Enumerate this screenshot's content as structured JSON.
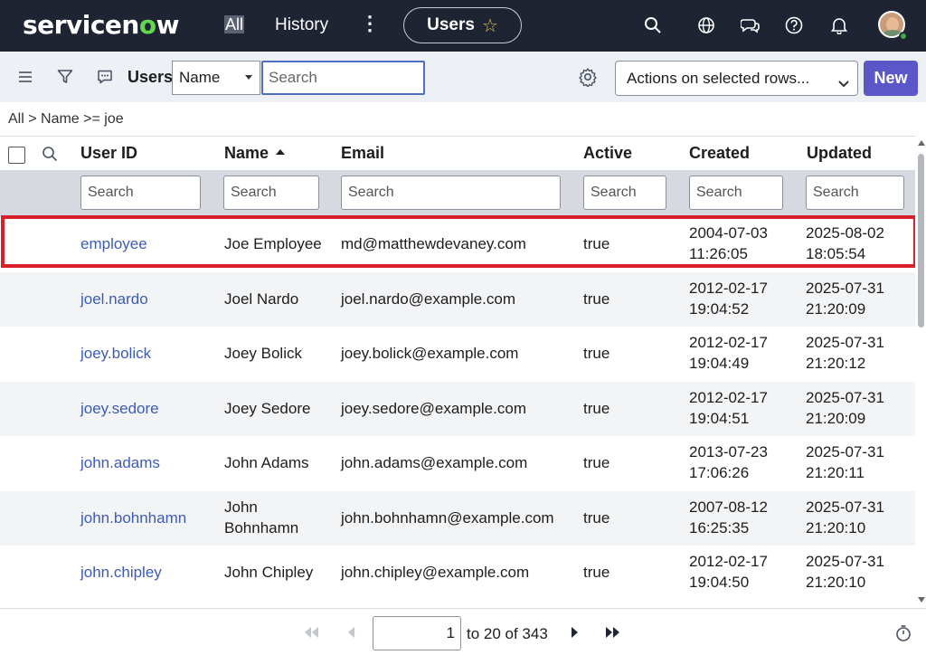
{
  "header": {
    "logo_main": "servicen",
    "logo_o": "o",
    "logo_end": "w",
    "all_label": "All",
    "history_label": "History",
    "more_label": "⋮",
    "context_title": "Users",
    "star": "☆",
    "icons": [
      "search-icon",
      "globe-icon",
      "chat-icon",
      "help-icon",
      "bell-icon"
    ]
  },
  "toolbar": {
    "list_title": "Users",
    "field_select_value": "Name",
    "search_placeholder": "Search",
    "actions_label": "Actions on selected rows...",
    "new_label": "New",
    "accent_color": "#5b57c9"
  },
  "breadcrumb": "All > Name >= joe",
  "table": {
    "columns": [
      "User ID",
      "Name",
      "Email",
      "Active",
      "Created",
      "Updated"
    ],
    "sorted_column": "Name",
    "sort_direction": "ascending",
    "filter_placeholder": "Search",
    "rows": [
      {
        "user_id": "employee",
        "name": "Joe Employee",
        "email": "md@matthewdevaney.com",
        "active": "true",
        "created_date": "2004-07-03",
        "created_time": "11:26:05",
        "updated_date": "2025-08-02",
        "updated_time": "18:05:54"
      },
      {
        "user_id": "joel.nardo",
        "name": "Joel Nardo",
        "email": "joel.nardo@example.com",
        "active": "true",
        "created_date": "2012-02-17",
        "created_time": "19:04:52",
        "updated_date": "2025-07-31",
        "updated_time": "21:20:09"
      },
      {
        "user_id": "joey.bolick",
        "name": "Joey Bolick",
        "email": "joey.bolick@example.com",
        "active": "true",
        "created_date": "2012-02-17",
        "created_time": "19:04:49",
        "updated_date": "2025-07-31",
        "updated_time": "21:20:12"
      },
      {
        "user_id": "joey.sedore",
        "name": "Joey Sedore",
        "email": "joey.sedore@example.com",
        "active": "true",
        "created_date": "2012-02-17",
        "created_time": "19:04:51",
        "updated_date": "2025-07-31",
        "updated_time": "21:20:09"
      },
      {
        "user_id": "john.adams",
        "name": "John Adams",
        "email": "john.adams@example.com",
        "active": "true",
        "created_date": "2013-07-23",
        "created_time": "17:06:26",
        "updated_date": "2025-07-31",
        "updated_time": "21:20:11"
      },
      {
        "user_id": "john.bohnhamn",
        "name": "John\nBohnhamn",
        "email": "john.bohnhamn@example.com",
        "active": "true",
        "created_date": "2007-08-12",
        "created_time": "16:25:35",
        "updated_date": "2025-07-31",
        "updated_time": "21:20:10"
      },
      {
        "user_id": "john.chipley",
        "name": "John Chipley",
        "email": "john.chipley@example.com",
        "active": "true",
        "created_date": "2012-02-17",
        "created_time": "19:04:50",
        "updated_date": "2025-07-31",
        "updated_time": "21:20:10"
      }
    ],
    "highlight_color": "#d9202a"
  },
  "pagination": {
    "current_page_value": "1",
    "range_text": "to 20 of 343"
  }
}
